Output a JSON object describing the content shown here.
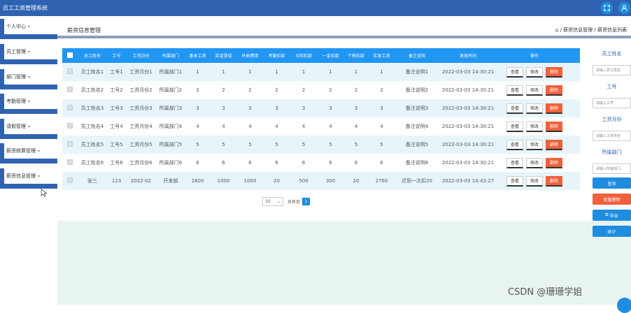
{
  "app": {
    "title": "员工工资管理系统",
    "colors": {
      "primary": "#2f63b1",
      "accent": "#2196f3",
      "danger": "#f0603a",
      "content_bg": "#e8f4f0"
    }
  },
  "topbar_icons": [
    "fullscreen-icon",
    "user-icon"
  ],
  "sidebar": {
    "items": [
      {
        "label": "个人中心"
      },
      {
        "label": "员工管理"
      },
      {
        "label": "部门管理"
      },
      {
        "label": "考勤管理"
      },
      {
        "label": "请假管理"
      },
      {
        "label": "薪资核算管理"
      },
      {
        "label": "薪资信息管理"
      }
    ]
  },
  "header": {
    "page_title": "薪资信息管理",
    "breadcrumb": "/ 薪资信息管理 / 薪资信息列表"
  },
  "table": {
    "columns": [
      "员工姓名",
      "工号",
      "工资月份",
      "所属部门",
      "基本工资",
      "奖金提成",
      "补贴费用",
      "考勤扣款",
      "五险扣款",
      "一金扣款",
      "个税扣款",
      "实发工资",
      "备注说明",
      "发放时间",
      "操作"
    ],
    "action_labels": {
      "view": "查看",
      "edit": "修改",
      "delete": "删除"
    },
    "rows": [
      [
        "员工姓名1",
        "工号1",
        "工资月份1",
        "所属部门1",
        "1",
        "1",
        "1",
        "1",
        "1",
        "1",
        "1",
        "1",
        "备注说明1",
        "2022-03-03 14:30:21"
      ],
      [
        "员工姓名2",
        "工号2",
        "工资月份2",
        "所属部门2",
        "2",
        "2",
        "2",
        "2",
        "2",
        "2",
        "2",
        "2",
        "备注说明2",
        "2022-03-03 14:30:21"
      ],
      [
        "员工姓名3",
        "工号3",
        "工资月份3",
        "所属部门3",
        "3",
        "3",
        "3",
        "3",
        "3",
        "3",
        "3",
        "3",
        "备注说明3",
        "2022-03-03 14:30:21"
      ],
      [
        "员工姓名4",
        "工号4",
        "工资月份4",
        "所属部门4",
        "4",
        "4",
        "4",
        "4",
        "4",
        "4",
        "4",
        "4",
        "备注说明4",
        "2022-03-03 14:30:21"
      ],
      [
        "员工姓名5",
        "工号5",
        "工资月份5",
        "所属部门5",
        "5",
        "5",
        "5",
        "5",
        "5",
        "5",
        "5",
        "5",
        "备注说明5",
        "2022-03-03 14:30:21"
      ],
      [
        "员工姓名6",
        "工号6",
        "工资月份6",
        "所属部门6",
        "6",
        "6",
        "6",
        "6",
        "6",
        "6",
        "6",
        "6",
        "备注说明6",
        "2022-03-03 14:30:21"
      ],
      [
        "张三",
        "123",
        "2022-02",
        "开发部",
        "1600",
        "1000",
        "1000",
        "20",
        "500",
        "300",
        "20",
        "2760",
        "迟到一次扣20",
        "2022-03-03 14:43:27"
      ]
    ]
  },
  "pagination": {
    "page_size": "10",
    "total_label": "共有页",
    "current_page": "1"
  },
  "search_panel": {
    "fields": [
      {
        "label": "员工姓名",
        "placeholder": "请输入员工姓名"
      },
      {
        "label": "工号",
        "placeholder": "请输入工号"
      },
      {
        "label": "工资月份",
        "placeholder": "请输入工资月份"
      },
      {
        "label": "所属部门",
        "placeholder": "请输入所属部门"
      }
    ],
    "buttons": {
      "search": "查询",
      "batch_delete": "批量删除",
      "export": "导出",
      "stats": "统计"
    }
  },
  "watermark": "CSDN @珊珊学姐"
}
